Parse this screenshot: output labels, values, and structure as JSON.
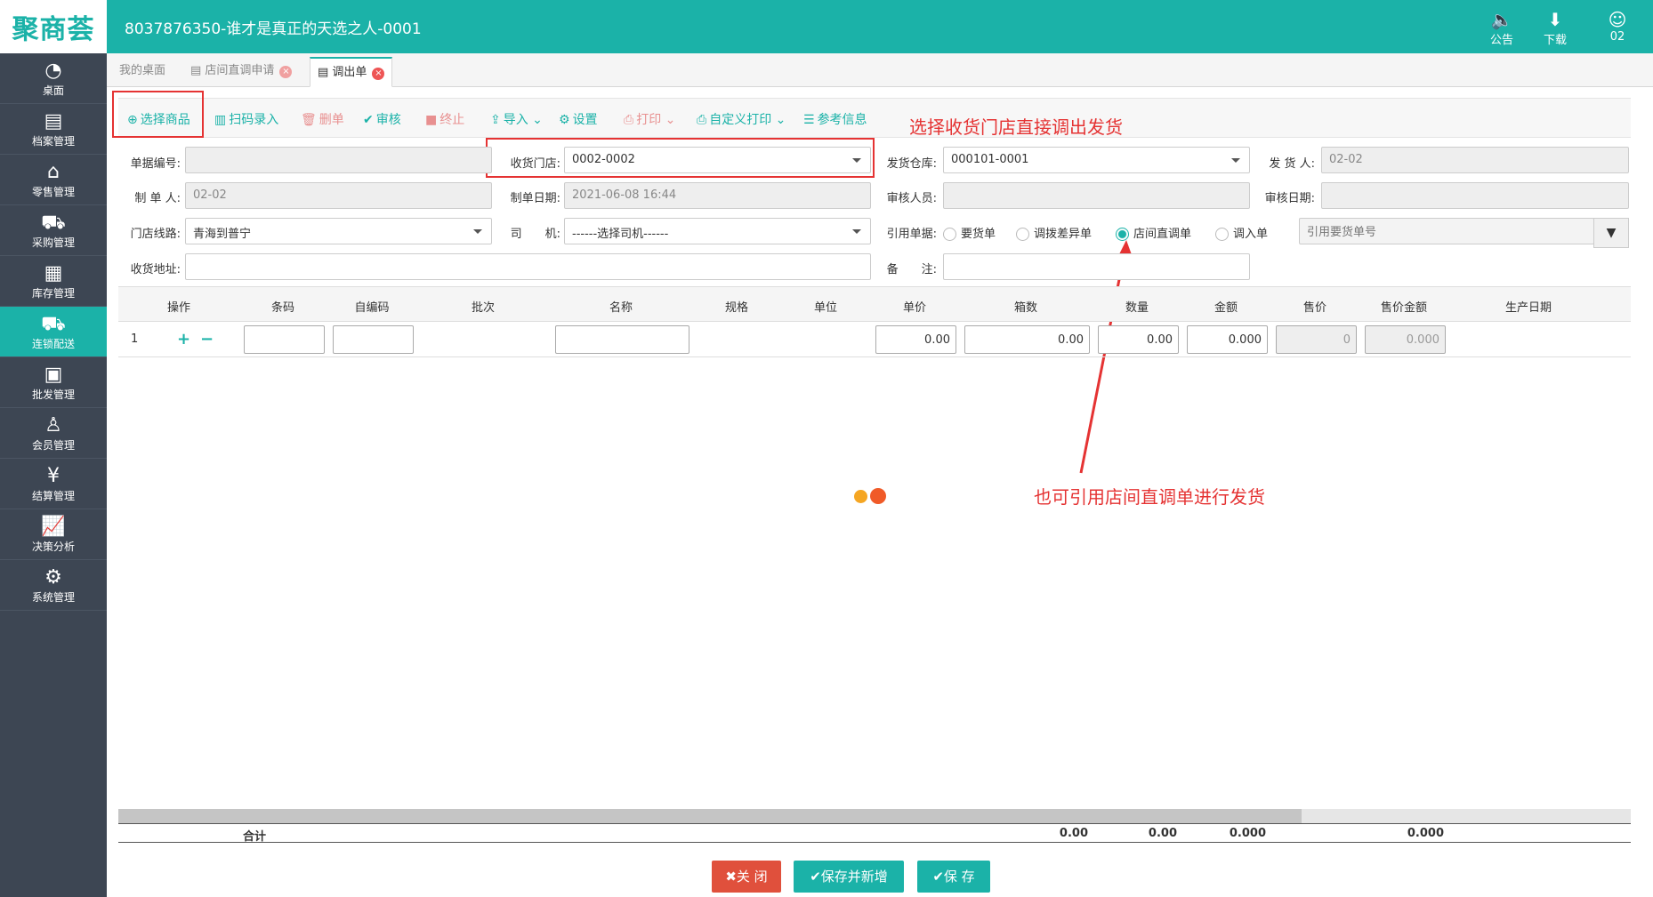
{
  "app": {
    "logo": "聚商荟",
    "title": "8037876350-谁才是真正的天选之人-0001"
  },
  "topbar": [
    {
      "icon": "speaker-icon",
      "glyph": "🔈",
      "label": "公告"
    },
    {
      "icon": "download-icon",
      "glyph": "⬇",
      "label": "下载"
    },
    {
      "icon": "avatar-icon",
      "glyph": "☺",
      "label": "02"
    }
  ],
  "sidebar": [
    {
      "label": "桌面",
      "icon": "dashboard-icon",
      "glyph": "◔"
    },
    {
      "label": "档案管理",
      "icon": "archive-icon",
      "glyph": "▤"
    },
    {
      "label": "零售管理",
      "icon": "store-icon",
      "glyph": "⌂"
    },
    {
      "label": "采购管理",
      "icon": "cart-icon",
      "glyph": "⛟"
    },
    {
      "label": "库存管理",
      "icon": "inventory-icon",
      "glyph": "▦"
    },
    {
      "label": "连锁配送",
      "icon": "truck-icon",
      "glyph": "⛟",
      "active": true
    },
    {
      "label": "批发管理",
      "icon": "wholesale-icon",
      "glyph": "▣"
    },
    {
      "label": "会员管理",
      "icon": "member-icon",
      "glyph": "♙"
    },
    {
      "label": "结算管理",
      "icon": "settlement-icon",
      "glyph": "¥"
    },
    {
      "label": "决策分析",
      "icon": "chart-icon",
      "glyph": "📈"
    },
    {
      "label": "系统管理",
      "icon": "settings-icon",
      "glyph": "⚙"
    }
  ],
  "tabs": {
    "home": "我的桌面",
    "t1": "店间直调申请",
    "t2": "调出单",
    "close": "×"
  },
  "toolbar": {
    "select": "选择商品",
    "scan": "扫码录入",
    "delete": "删单",
    "audit": "审核",
    "stop": "终止",
    "import": "导入",
    "settings": "设置",
    "print": "打印",
    "custom_print": "自定义打印",
    "reference": "参考信息"
  },
  "annotations": {
    "top": "选择收货门店直接调出发货",
    "bottom": "也可引用店间直调单进行发货"
  },
  "form": {
    "doc_no_label": "单据编号:",
    "doc_no": "",
    "store_label": "收货门店:",
    "store": "0002-0002",
    "warehouse_label": "发货仓库:",
    "warehouse": "000101-0001",
    "sender_label": "发 货 人:",
    "sender": "02-02",
    "maker_label": "制 单 人:",
    "maker": "02-02",
    "make_date_label": "制单日期:",
    "make_date": "2021-06-08 16:44",
    "auditor_label": "审核人员:",
    "auditor": "",
    "audit_date_label": "审核日期:",
    "audit_date": "",
    "route_label": "门店线路:",
    "route": "青海到普宁",
    "driver_label": "司　　机:",
    "driver": "------选择司机------",
    "ref_label": "引用单据:",
    "ref_options": [
      "要货单",
      "调拨差异单",
      "店间直调单",
      "调入单"
    ],
    "ref_selected": "店间直调单",
    "ref_placeholder": "引用要货单号",
    "address_label": "收货地址:",
    "address": "",
    "remark_label": "备　　注:",
    "remark": ""
  },
  "grid": {
    "headers": [
      "操作",
      "条码",
      "自编码",
      "批次",
      "名称",
      "规格",
      "单位",
      "单价",
      "箱数",
      "数量",
      "金额",
      "售价",
      "售价金额",
      "生产日期"
    ],
    "row": {
      "index": "1",
      "add": "+",
      "remove": "−",
      "price": "0.00",
      "boxes": "0.00",
      "qty": "0.00",
      "amount": "0.000",
      "sale_price": "0",
      "sale_amount": "0.000"
    },
    "total": {
      "label": "合计",
      "boxes": "0.00",
      "qty": "0.00",
      "amount": "0.000",
      "sale_amount": "0.000"
    }
  },
  "buttons": {
    "close": "✖关 闭",
    "save_new": "✔保存并新增",
    "save": "✔保 存"
  },
  "colors": {
    "accent": "#1bb2a8",
    "sidebar": "#3d4653",
    "annotation": "#e53333"
  }
}
